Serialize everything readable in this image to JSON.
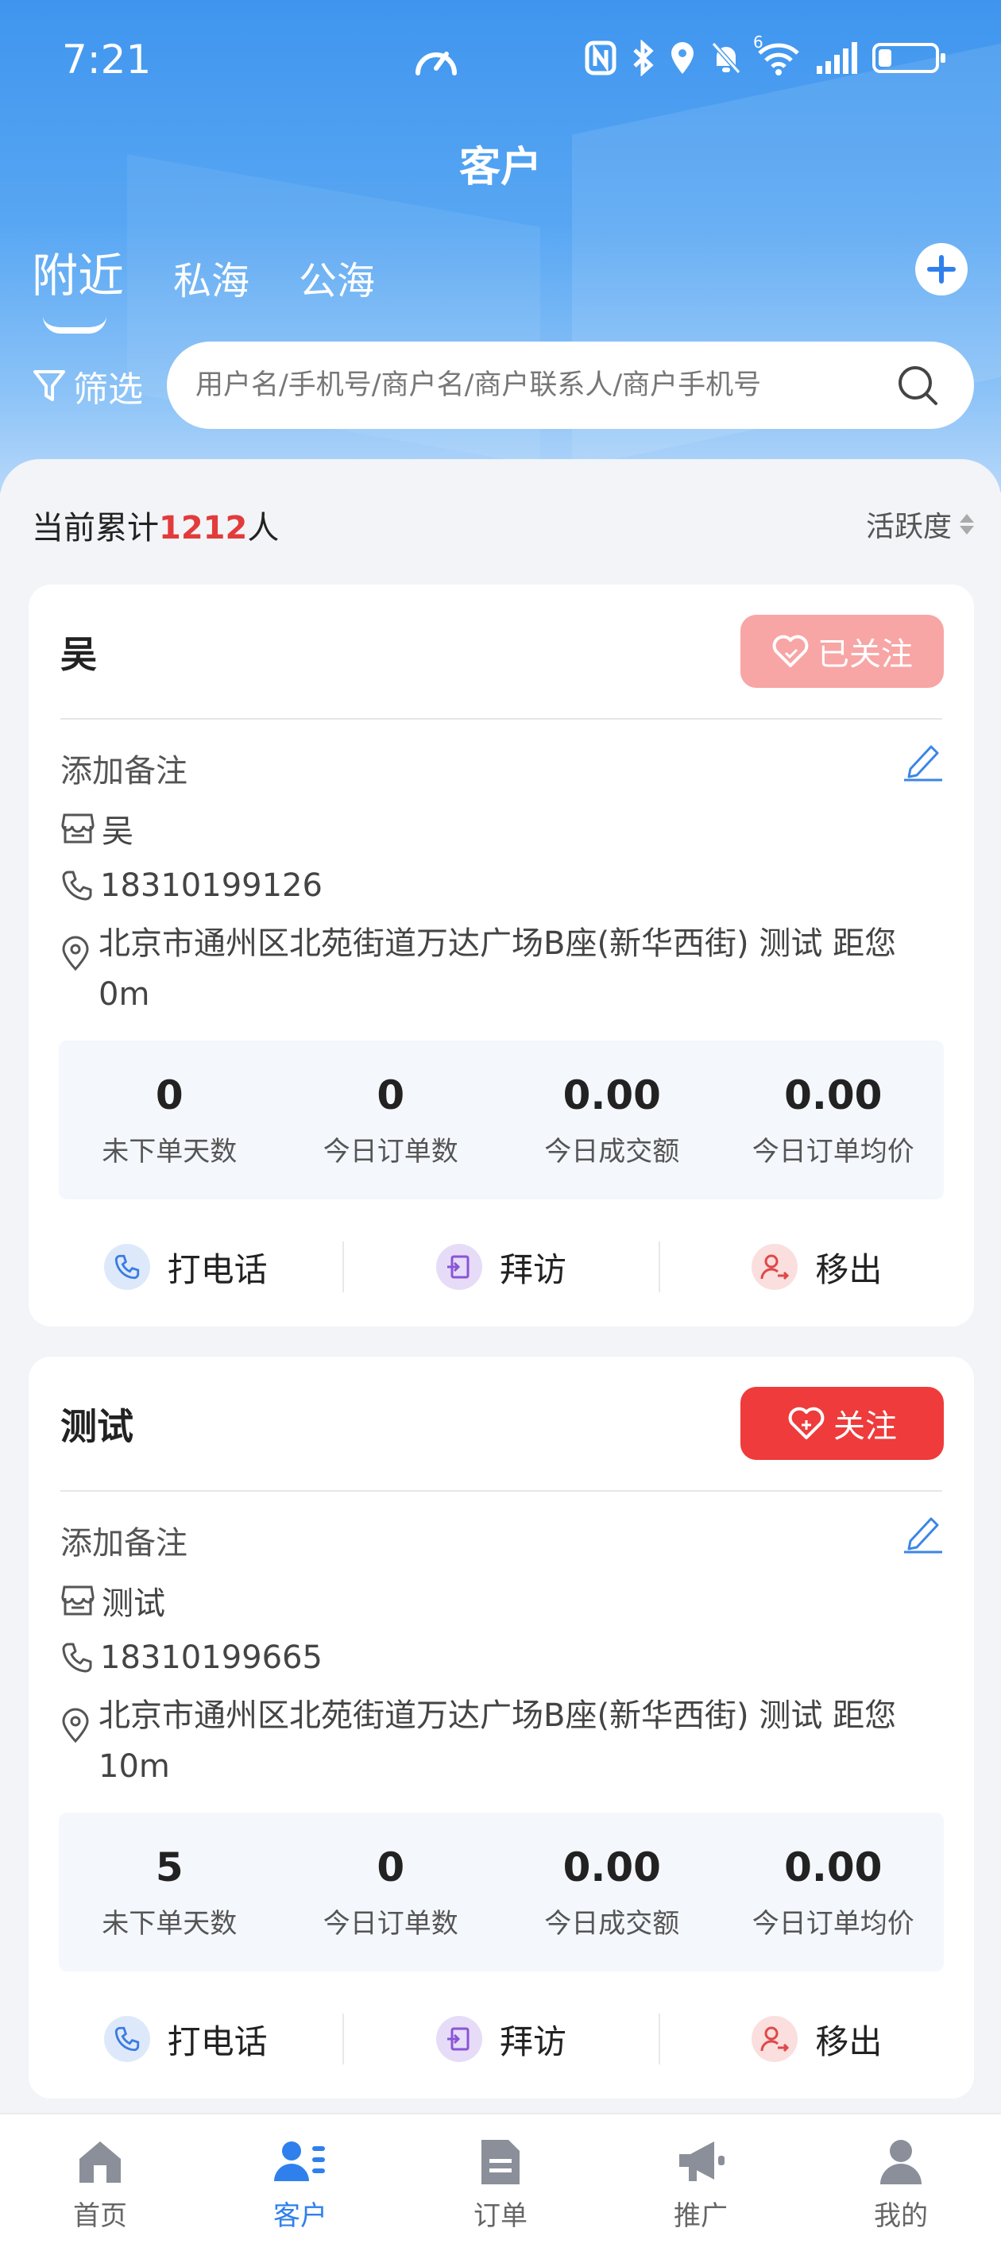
{
  "status_bar": {
    "time": "7:21",
    "network_label": "6"
  },
  "header": {
    "title": "客户"
  },
  "tabs": [
    {
      "label": "附近",
      "active": true
    },
    {
      "label": "私海",
      "active": false
    },
    {
      "label": "公海",
      "active": false
    }
  ],
  "filter": {
    "label": "筛选"
  },
  "search": {
    "placeholder": "用户名/手机号/商户名/商户联系人/商户手机号"
  },
  "summary": {
    "prefix": "当前累计",
    "count": "1212",
    "suffix": "人",
    "sort_label": "活跃度"
  },
  "customers": [
    {
      "name": "吴",
      "follow_label": "已关注",
      "followed": true,
      "remark": "添加备注",
      "shop": "吴",
      "phone": "18310199126",
      "address": "北京市通州区北苑街道万达广场B座(新华西街) 测试 距您0m",
      "stats": [
        {
          "value": "0",
          "label": "未下单天数"
        },
        {
          "value": "0",
          "label": "今日订单数"
        },
        {
          "value": "0.00",
          "label": "今日成交额"
        },
        {
          "value": "0.00",
          "label": "今日订单均价"
        }
      ],
      "actions": {
        "call": "打电话",
        "visit": "拜访",
        "remove": "移出"
      }
    },
    {
      "name": "测试",
      "follow_label": "关注",
      "followed": false,
      "remark": "添加备注",
      "shop": "测试",
      "phone": "18310199665",
      "address": "北京市通州区北苑街道万达广场B座(新华西街) 测试 距您10m",
      "stats": [
        {
          "value": "5",
          "label": "未下单天数"
        },
        {
          "value": "0",
          "label": "今日订单数"
        },
        {
          "value": "0.00",
          "label": "今日成交额"
        },
        {
          "value": "0.00",
          "label": "今日订单均价"
        }
      ],
      "actions": {
        "call": "打电话",
        "visit": "拜访",
        "remove": "移出"
      }
    }
  ],
  "bottom_nav": [
    {
      "label": "首页",
      "icon": "home-icon",
      "active": false
    },
    {
      "label": "客户",
      "icon": "customers-icon",
      "active": true
    },
    {
      "label": "订单",
      "icon": "orders-icon",
      "active": false
    },
    {
      "label": "推广",
      "icon": "megaphone-icon",
      "active": false
    },
    {
      "label": "我的",
      "icon": "profile-icon",
      "active": false
    }
  ],
  "colors": {
    "primary": "#2f80ed",
    "header_gradient_top": "#3f95ee",
    "highlight_red": "#e23b3b",
    "follow_red": "#ef3b3b",
    "followed_pink": "#f8a5a5"
  }
}
